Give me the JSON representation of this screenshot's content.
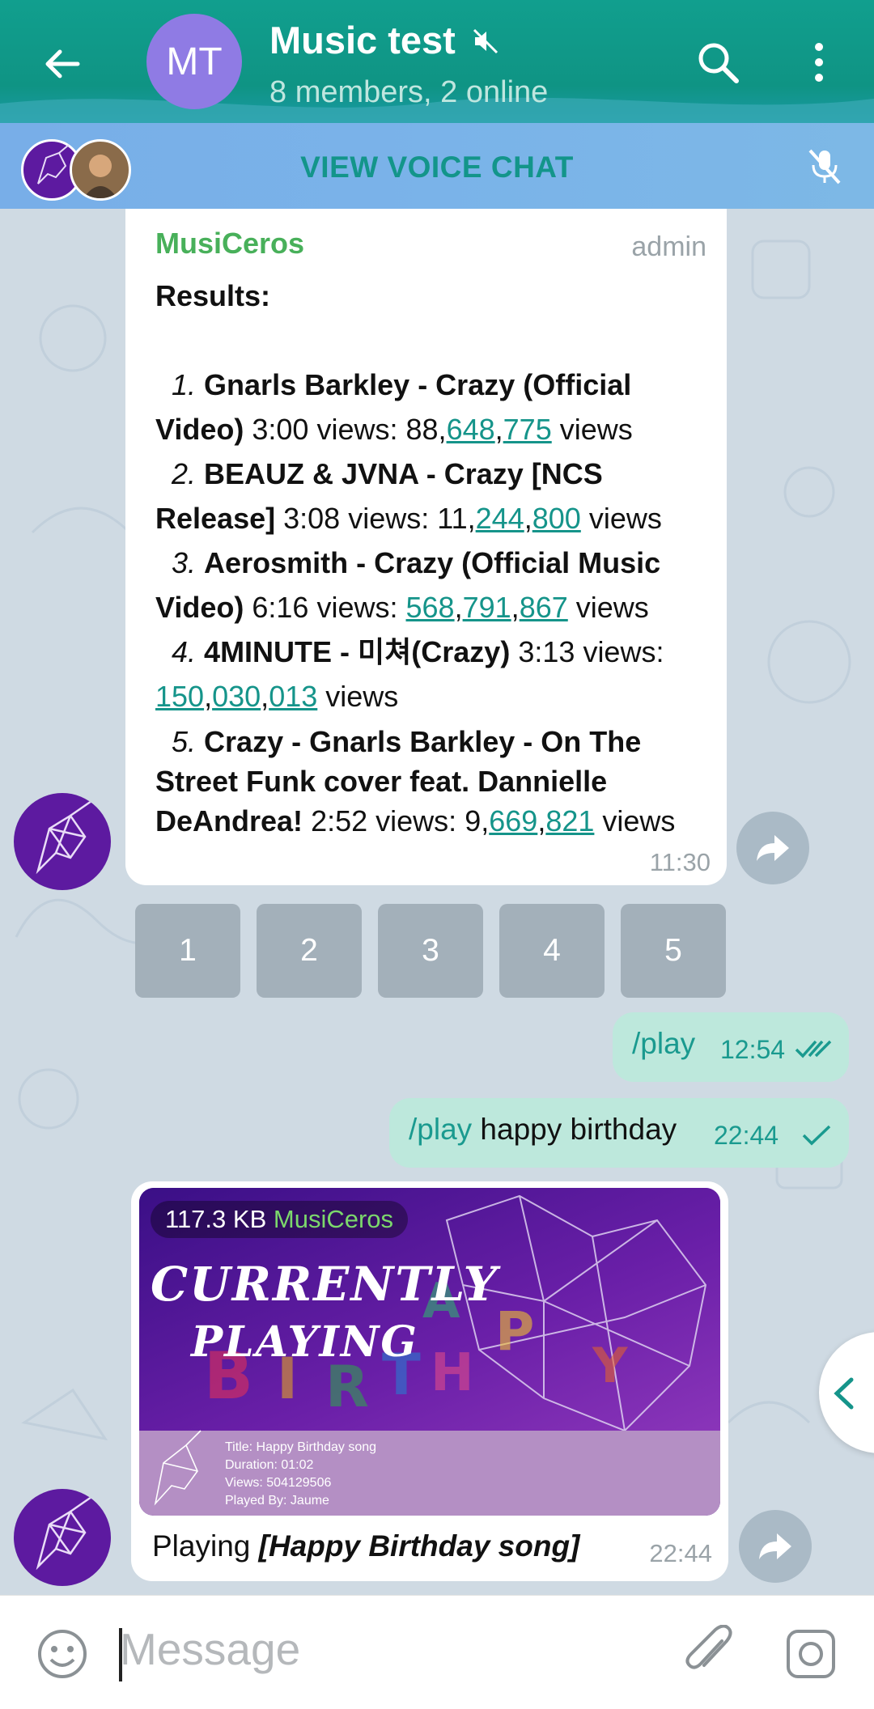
{
  "header": {
    "avatar_initials": "MT",
    "title": "Music test",
    "subtitle": "8 members, 2 online",
    "icons": [
      "back-arrow-icon",
      "muted-icon",
      "search-icon",
      "more-vert-icon"
    ]
  },
  "voice_chat": {
    "label": "VIEW VOICE CHAT",
    "icon": "mic-off-icon"
  },
  "message1": {
    "sender": "MusiCeros",
    "role": "admin",
    "heading": "Results:",
    "results": [
      {
        "num": "1.",
        "title": "Gnarls Barkley - Crazy (Official Video)",
        "duration": "3:00",
        "views_prefix": "views: ",
        "views_parts": [
          "88",
          "648",
          "775"
        ],
        "views_suffix": " views"
      },
      {
        "num": "2.",
        "title": "BEAUZ & JVNA - Crazy [NCS Release]",
        "duration": "3:08",
        "views_prefix": "views: ",
        "views_parts": [
          "11",
          "244",
          "800"
        ],
        "views_suffix": " views"
      },
      {
        "num": "3.",
        "title": "Aerosmith - Crazy (Official Music Video)",
        "duration": "6:16",
        "views_prefix": "views: ",
        "views_parts": [
          "568",
          "791",
          "867"
        ],
        "views_suffix": " views"
      },
      {
        "num": "4.",
        "title": "4MINUTE - 미쳐(Crazy)",
        "duration": "3:13",
        "views_prefix": "views: ",
        "views_parts": [
          "150",
          "030",
          "013"
        ],
        "views_suffix": " views"
      },
      {
        "num": "5.",
        "title": "Crazy - Gnarls Barkley - On The Street Funk cover feat. Dannielle DeAndrea!",
        "duration": "2:52",
        "views_prefix": "views: ",
        "views_parts": [
          "9",
          "669",
          "821"
        ],
        "views_suffix": " views"
      }
    ],
    "time": "11:30"
  },
  "keyboard": [
    "1",
    "2",
    "3",
    "4",
    "5"
  ],
  "outgoing": [
    {
      "command": "/play",
      "text": "",
      "time": "12:54",
      "status": "read"
    },
    {
      "command": "/play",
      "text": " happy birthday",
      "time": "22:44",
      "status": "sent"
    }
  ],
  "message2": {
    "file_size": "117.3 KB",
    "sender": "MusiCeros",
    "image_heading_line1": "CURRENTLY",
    "image_heading_line2": "PLAYING",
    "image_info": [
      "Title: Happy Birthday song",
      "Duration: 01:02",
      "Views: 504129506",
      "Played By: Jaume"
    ],
    "caption_prefix": "Playing ",
    "caption_title": "[Happy Birthday song]",
    "time": "22:44"
  },
  "input": {
    "placeholder": "Message",
    "icons": [
      "emoji-icon",
      "attach-icon",
      "camera-icon"
    ]
  },
  "colors": {
    "header": "#0f9484",
    "accent": "#15948a",
    "sender": "#48b05a",
    "outgoing_bubble": "#bde8dc",
    "voice_bar": "#7ab3e9"
  }
}
